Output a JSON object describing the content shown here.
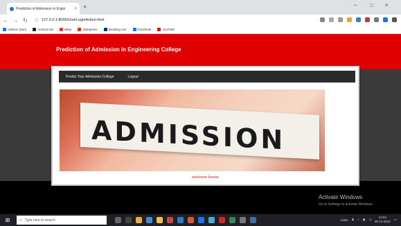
{
  "browser": {
    "tab_title": "Prediction of Admission in Engin",
    "tab_close": "×",
    "new_tab": "+",
    "url": "127.0.0.1:8000/UserLoginAction.html",
    "window_minimize": "–",
    "window_restore": "□",
    "window_close": "×",
    "bookmarks": [
      {
        "label": "Addons Store",
        "color": "#1a73e8"
      },
      {
        "label": "Amazon.de",
        "color": "#222222"
      },
      {
        "label": "eBay",
        "color": "#e53238"
      },
      {
        "label": "AliExpress",
        "color": "#e62e04"
      },
      {
        "label": "Booking.com",
        "color": "#003580"
      },
      {
        "label": "Facebook",
        "color": "#1877f2"
      },
      {
        "label": "YouTube",
        "color": "#ff0000"
      }
    ]
  },
  "site": {
    "title": "Prediction of Admission in Engineering College",
    "menu": [
      "Predict Your Admission College",
      "Logout"
    ],
    "hero_text": "ADMISSION",
    "welcome": "welcome kumar"
  },
  "windows": {
    "activate_title": "Activate Windows",
    "activate_sub": "Go to Settings to activate Windows.",
    "search_placeholder": "Type here to search",
    "tray_links": "Links",
    "clock_time": "14:54",
    "clock_date": "30-11-2022"
  },
  "colors": {
    "header_red": "#e10000",
    "welcome_red": "#d32020",
    "menubar": "#2b2b2b"
  }
}
